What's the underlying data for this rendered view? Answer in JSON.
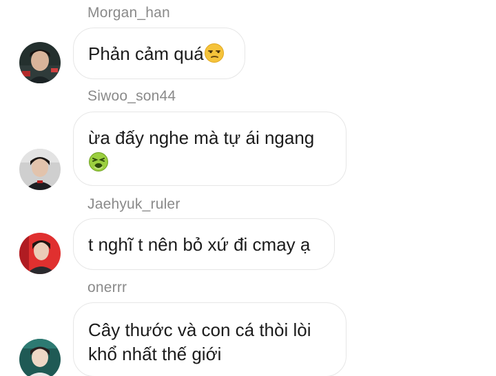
{
  "messages": [
    {
      "sender": "Morgan_han",
      "text": "Phản cảm quá",
      "emoji_icon": "unamused-face-emoji"
    },
    {
      "sender": "Siwoo_son44",
      "text": "ừa đấy nghe mà tự ái ngang",
      "emoji_icon": "nauseated-face-emoji"
    },
    {
      "sender": "Jaehyuk_ruler",
      "text": "t nghĩ t nên bỏ xứ đi cmay ạ"
    },
    {
      "sender": "onerrr",
      "text": "Cây thước và con cá thòi lòi\nkhổ nhất thế giới"
    }
  ],
  "colors": {
    "bubble_border": "#e6e6e6",
    "sender_text": "#8a8a8a",
    "message_text": "#1c1c1c"
  }
}
